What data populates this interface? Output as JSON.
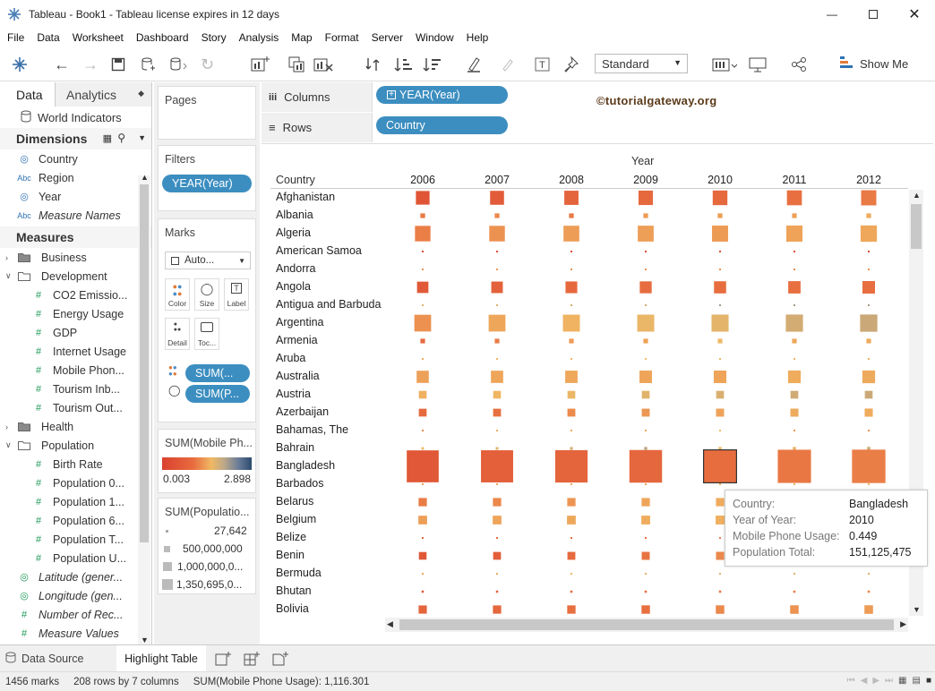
{
  "window": {
    "title": "Tableau - Book1 - Tableau license expires in 12 days"
  },
  "menu": [
    "File",
    "Data",
    "Worksheet",
    "Dashboard",
    "Story",
    "Analysis",
    "Map",
    "Format",
    "Server",
    "Window",
    "Help"
  ],
  "toolbar": {
    "fit_mode": "Standard",
    "show_me": "Show Me"
  },
  "data_pane": {
    "tab_data": "Data",
    "tab_analytics": "Analytics",
    "source": "World Indicators",
    "dimensions_title": "Dimensions",
    "dimensions": [
      {
        "icon": "globe",
        "label": "Country"
      },
      {
        "icon": "abc",
        "label": "Region"
      },
      {
        "icon": "globe",
        "label": "Year"
      },
      {
        "icon": "abc",
        "label": "Measure Names",
        "italic": true
      }
    ],
    "measures_title": "Measures",
    "measures": [
      {
        "kind": "folder",
        "label": "Business",
        "open": false
      },
      {
        "kind": "folder",
        "label": "Development",
        "open": true
      },
      {
        "kind": "field",
        "label": "CO2 Emissio..."
      },
      {
        "kind": "field",
        "label": "Energy Usage"
      },
      {
        "kind": "field",
        "label": "GDP"
      },
      {
        "kind": "field",
        "label": "Internet Usage"
      },
      {
        "kind": "field",
        "label": "Mobile Phon..."
      },
      {
        "kind": "field",
        "label": "Tourism Inb..."
      },
      {
        "kind": "field",
        "label": "Tourism Out..."
      },
      {
        "kind": "folder",
        "label": "Health",
        "open": false
      },
      {
        "kind": "folder",
        "label": "Population",
        "open": true
      },
      {
        "kind": "field",
        "label": "Birth Rate"
      },
      {
        "kind": "field",
        "label": "Population 0..."
      },
      {
        "kind": "field",
        "label": "Population 1..."
      },
      {
        "kind": "field",
        "label": "Population 6..."
      },
      {
        "kind": "field",
        "label": "Population T..."
      },
      {
        "kind": "field",
        "label": "Population U..."
      },
      {
        "kind": "globe",
        "label": "Latitude (gener...",
        "italic": true
      },
      {
        "kind": "globe",
        "label": "Longitude (gen...",
        "italic": true
      },
      {
        "kind": "field",
        "label": "Number of Rec...",
        "italic": true
      },
      {
        "kind": "field",
        "label": "Measure Values",
        "italic": true
      }
    ]
  },
  "pages": {
    "title": "Pages"
  },
  "filters": {
    "title": "Filters",
    "pill": "YEAR(Year)"
  },
  "marks": {
    "title": "Marks",
    "type": "Auto...",
    "buttons": [
      "Color",
      "Size",
      "Label",
      "Detail",
      "Toc..."
    ],
    "pill_color": "SUM(...",
    "pill_size": "SUM(P..."
  },
  "color_legend": {
    "title": "SUM(Mobile Ph...",
    "min": "0.003",
    "max": "2.898"
  },
  "size_legend": {
    "title": "SUM(Populatio...",
    "entries": [
      "27,642",
      "500,000,000",
      "1,000,000,0...",
      "1,350,695,0..."
    ]
  },
  "columns": {
    "label": "Columns",
    "pill": "YEAR(Year)"
  },
  "rows": {
    "label": "Rows",
    "pill": "Country"
  },
  "watermark": "©tutorialgateway.org",
  "view": {
    "axis_title": "Year",
    "row_header": "Country",
    "years": [
      "2006",
      "2007",
      "2008",
      "2009",
      "2010",
      "2011",
      "2012"
    ],
    "countries": [
      "Afghanistan",
      "Albania",
      "Algeria",
      "American Samoa",
      "Andorra",
      "Angola",
      "Antigua and Barbuda",
      "Argentina",
      "Armenia",
      "Aruba",
      "Australia",
      "Austria",
      "Azerbaijan",
      "Bahamas, The",
      "Bahrain",
      "Bangladesh",
      "Barbados",
      "Belarus",
      "Belgium",
      "Belize",
      "Benin",
      "Bermuda",
      "Bhutan",
      "Bolivia"
    ]
  },
  "chart_data": {
    "type": "heatmap",
    "x": [
      "2006",
      "2007",
      "2008",
      "2009",
      "2010",
      "2011",
      "2012"
    ],
    "y": [
      "Afghanistan",
      "Albania",
      "Algeria",
      "American Samoa",
      "Andorra",
      "Angola",
      "Antigua and Barbuda",
      "Argentina",
      "Armenia",
      "Aruba",
      "Australia",
      "Austria",
      "Azerbaijan",
      "Bahamas, The",
      "Bahrain",
      "Bangladesh",
      "Barbados",
      "Belarus",
      "Belgium",
      "Belize",
      "Benin",
      "Bermuda",
      "Bhutan",
      "Bolivia"
    ],
    "size_measure": "SUM(Population Total)",
    "color_measure": "SUM(Mobile Phone Usage)",
    "color_range": [
      0.003,
      2.898
    ],
    "size": [
      [
        26000000,
        27000000,
        28000000,
        29000000,
        30000000,
        31000000,
        32000000
      ],
      [
        3100000,
        3100000,
        3100000,
        3100000,
        3100000,
        3100000,
        3100000
      ],
      [
        33500000,
        34000000,
        34600000,
        35200000,
        35800000,
        36500000,
        37200000
      ],
      [
        60000,
        60000,
        60000,
        60000,
        60000,
        60000,
        60000
      ],
      [
        80000,
        80000,
        80000,
        80000,
        80000,
        80000,
        80000
      ],
      [
        18000000,
        18600000,
        19200000,
        19800000,
        20500000,
        21200000,
        21900000
      ],
      [
        85000,
        86000,
        87000,
        88000,
        88000,
        89000,
        90000
      ],
      [
        39000000,
        39400000,
        39800000,
        40200000,
        40600000,
        41000000,
        41400000
      ],
      [
        3000000,
        3000000,
        3000000,
        3000000,
        3000000,
        3000000,
        3000000
      ],
      [
        100000,
        100000,
        100000,
        100000,
        100000,
        100000,
        100000
      ],
      [
        20700000,
        21000000,
        21300000,
        21700000,
        22000000,
        22300000,
        22700000
      ],
      [
        8300000,
        8300000,
        8300000,
        8400000,
        8400000,
        8400000,
        8400000
      ],
      [
        8500000,
        8600000,
        8700000,
        8800000,
        9000000,
        9100000,
        9200000
      ],
      [
        330000,
        335000,
        340000,
        345000,
        350000,
        355000,
        360000
      ],
      [
        900000,
        1000000,
        1100000,
        1200000,
        1250000,
        1300000,
        1320000
      ],
      [
        142000000,
        144000000,
        146000000,
        148500000,
        151125475,
        153500000,
        155500000
      ],
      [
        275000,
        276000,
        277000,
        278000,
        279000,
        280000,
        281000
      ],
      [
        9600000,
        9560000,
        9530000,
        9500000,
        9490000,
        9470000,
        9460000
      ],
      [
        10500000,
        10600000,
        10700000,
        10800000,
        10900000,
        11000000,
        11100000
      ],
      [
        290000,
        295000,
        300000,
        305000,
        310000,
        315000,
        320000
      ],
      [
        8200000,
        8450000,
        8700000,
        8950000,
        9200000,
        9500000,
        9800000
      ],
      [
        64000,
        64000,
        64000,
        64000,
        64000,
        64000,
        64000
      ],
      [
        680000,
        690000,
        700000,
        710000,
        720000,
        730000,
        740000
      ],
      [
        9400000,
        9550000,
        9700000,
        9850000,
        10000000,
        10150000,
        10300000
      ]
    ],
    "mobile_usage": [
      [
        0.1,
        0.17,
        0.29,
        0.38,
        0.37,
        0.5,
        0.6
      ],
      [
        0.6,
        0.73,
        0.6,
        0.9,
        0.92,
        0.96,
        1.08
      ],
      [
        0.63,
        0.81,
        0.92,
        0.93,
        0.89,
        0.99,
        1.03
      ],
      [
        0.04,
        0.04,
        0.04,
        0.04,
        0.04,
        0.04,
        0.04
      ],
      [
        0.8,
        0.85,
        0.82,
        0.78,
        0.75,
        0.74,
        0.82
      ],
      [
        0.14,
        0.25,
        0.37,
        0.43,
        0.46,
        0.5,
        0.48
      ],
      [
        1.37,
        1.42,
        1.54,
        1.53,
        1.96,
        1.99,
        1.98
      ],
      [
        0.8,
        1.02,
        1.17,
        1.29,
        1.35,
        1.51,
        1.6
      ],
      [
        0.42,
        0.62,
        0.89,
        0.96,
        1.25,
        1.04,
        1.07
      ],
      [
        1.1,
        1.16,
        1.2,
        1.22,
        1.26,
        1.3,
        1.33
      ],
      [
        0.97,
        1.02,
        1.03,
        1.01,
        1.01,
        1.08,
        1.06
      ],
      [
        1.13,
        1.2,
        1.28,
        1.36,
        1.45,
        1.54,
        1.59
      ],
      [
        0.38,
        0.51,
        0.74,
        0.86,
        0.99,
        1.07,
        1.08
      ],
      [
        0.74,
        1.09,
        1.06,
        1.04,
        1.24,
        0.86,
        0.81
      ],
      [
        1.24,
        1.37,
        1.51,
        1.73,
        1.25,
        1.33,
        1.6
      ],
      [
        0.13,
        0.22,
        0.29,
        0.33,
        0.449,
        0.57,
        0.63
      ],
      [
        0.94,
        1.02,
        1.02,
        1.03,
        1.16,
        1.27,
        1.23
      ],
      [
        0.61,
        0.72,
        0.84,
        1.01,
        1.08,
        1.12,
        1.12
      ],
      [
        0.93,
        1.01,
        1.04,
        1.09,
        1.13,
        1.13,
        1.11
      ],
      [
        0.35,
        0.32,
        0.5,
        0.54,
        0.62,
        0.7,
        0.53
      ],
      [
        0.12,
        0.21,
        0.39,
        0.55,
        0.73,
        0.84,
        0.9
      ],
      [
        1.0,
        1.07,
        1.27,
        1.34,
        1.36,
        1.4,
        1.42
      ],
      [
        0.12,
        0.23,
        0.36,
        0.46,
        0.55,
        0.65,
        0.72
      ],
      [
        0.3,
        0.34,
        0.5,
        0.5,
        0.72,
        0.82,
        0.91
      ]
    ],
    "selected": {
      "country": "Bangladesh",
      "year": "2010"
    }
  },
  "tooltip": [
    {
      "key": "Country:",
      "value": "Bangladesh"
    },
    {
      "key": "Year of Year:",
      "value": "2010"
    },
    {
      "key": "Mobile Phone Usage:",
      "value": "0.449"
    },
    {
      "key": "Population Total:",
      "value": "151,125,475"
    }
  ],
  "tabs": {
    "data_source": "Data Source",
    "active_sheet": "Highlight Table"
  },
  "status": {
    "marks": "1456 marks",
    "rows_cols": "208 rows by 7 columns",
    "sum": "SUM(Mobile Phone Usage): 1,116.301"
  },
  "colors": {
    "pill": "#3c8ec0",
    "low": "#d9412f",
    "mid": "#f0b964",
    "high": "#2c4a6e"
  }
}
